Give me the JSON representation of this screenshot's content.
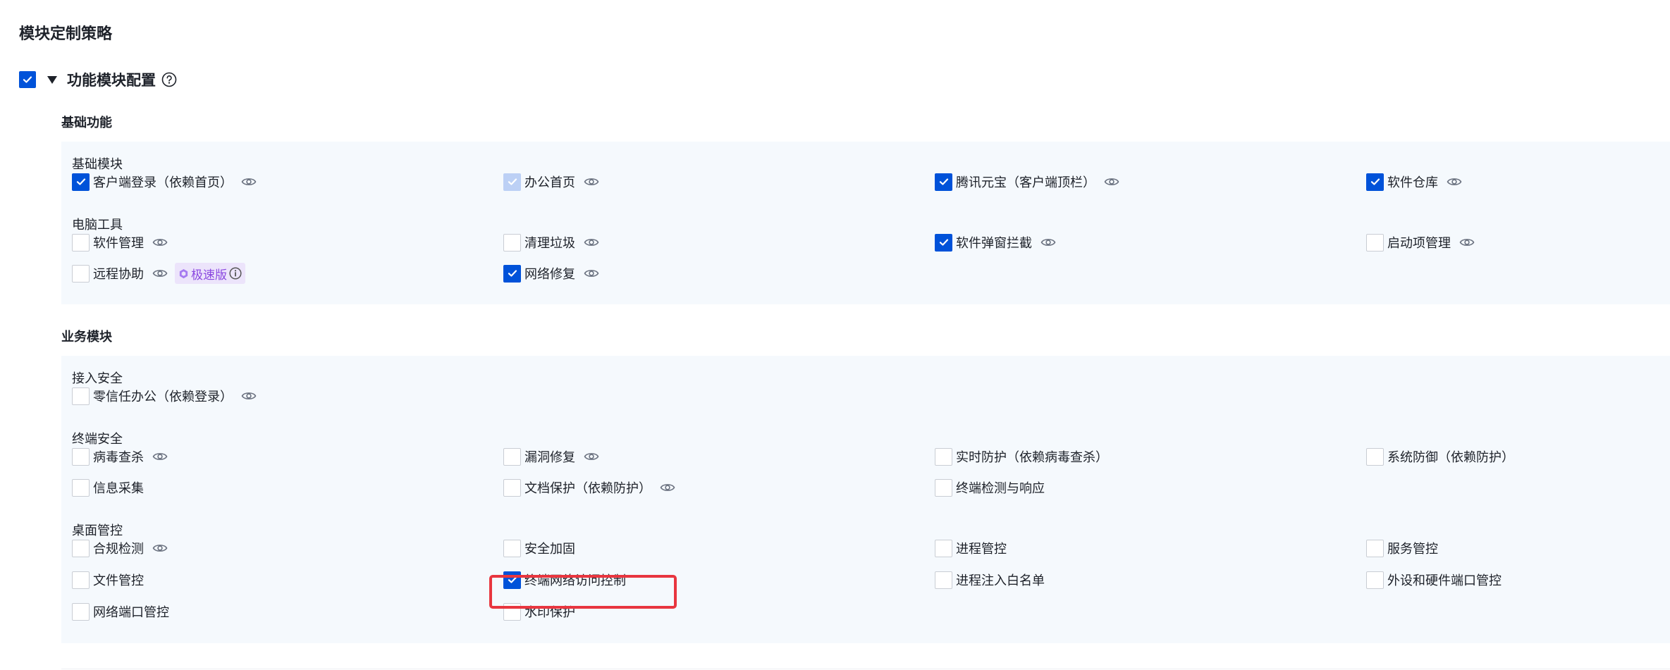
{
  "page": {
    "title": "模块定制策略"
  },
  "section": {
    "label": "功能模块配置",
    "checked": true,
    "expanded": true
  },
  "colors": {
    "accent": "#0052d9",
    "panel_bg": "#f5f9fd",
    "highlight": "#e8363f",
    "badge_bg": "#ece4fb",
    "badge_text": "#8a47e0"
  },
  "basic": {
    "title": "基础功能",
    "sub1": {
      "title": "基础模块",
      "items": [
        {
          "label": "客户端登录（依赖首页）",
          "checked": true,
          "eye": true
        },
        {
          "label": "办公首页",
          "checked": true,
          "disabled": true,
          "eye": true
        },
        {
          "label": "腾讯元宝（客户端顶栏）",
          "checked": true,
          "eye": true
        },
        {
          "label": "软件仓库",
          "checked": true,
          "eye": true
        }
      ]
    },
    "sub2": {
      "title": "电脑工具",
      "items": [
        {
          "label": "软件管理",
          "checked": false,
          "eye": true
        },
        {
          "label": "清理垃圾",
          "checked": false,
          "eye": true
        },
        {
          "label": "软件弹窗拦截",
          "checked": true,
          "eye": true
        },
        {
          "label": "启动项管理",
          "checked": false,
          "eye": true
        },
        {
          "label": "远程协助",
          "checked": false,
          "eye": true,
          "badge": "极速版"
        },
        {
          "label": "网络修复",
          "checked": true,
          "eye": true
        }
      ]
    }
  },
  "business": {
    "title": "业务模块",
    "sub1": {
      "title": "接入安全",
      "items": [
        {
          "label": "零信任办公（依赖登录）",
          "checked": false,
          "eye": true
        }
      ]
    },
    "sub2": {
      "title": "终端安全",
      "items": [
        {
          "label": "病毒查杀",
          "checked": false,
          "eye": true
        },
        {
          "label": "漏洞修复",
          "checked": false,
          "eye": true
        },
        {
          "label": "实时防护（依赖病毒查杀）",
          "checked": false,
          "eye": false
        },
        {
          "label": "系统防御（依赖防护）",
          "checked": false,
          "eye": false
        },
        {
          "label": "信息采集",
          "checked": false,
          "eye": false
        },
        {
          "label": "文档保护（依赖防护）",
          "checked": false,
          "eye": true
        },
        {
          "label": "终端检测与响应",
          "checked": false,
          "eye": false
        }
      ]
    },
    "sub3": {
      "title": "桌面管控",
      "items": [
        {
          "label": "合规检测",
          "checked": false,
          "eye": true
        },
        {
          "label": "安全加固",
          "checked": false,
          "eye": false
        },
        {
          "label": "进程管控",
          "checked": false,
          "eye": false
        },
        {
          "label": "服务管控",
          "checked": false,
          "eye": false
        },
        {
          "label": "文件管控",
          "checked": false,
          "eye": false
        },
        {
          "label": "终端网络访问控制",
          "checked": true,
          "eye": false,
          "highlighted": true
        },
        {
          "label": "进程注入白名单",
          "checked": false,
          "eye": false
        },
        {
          "label": "外设和硬件端口管控",
          "checked": false,
          "eye": false
        },
        {
          "label": "网络端口管控",
          "checked": false,
          "eye": false
        },
        {
          "label": "水印保护",
          "checked": false,
          "eye": false
        }
      ]
    }
  }
}
